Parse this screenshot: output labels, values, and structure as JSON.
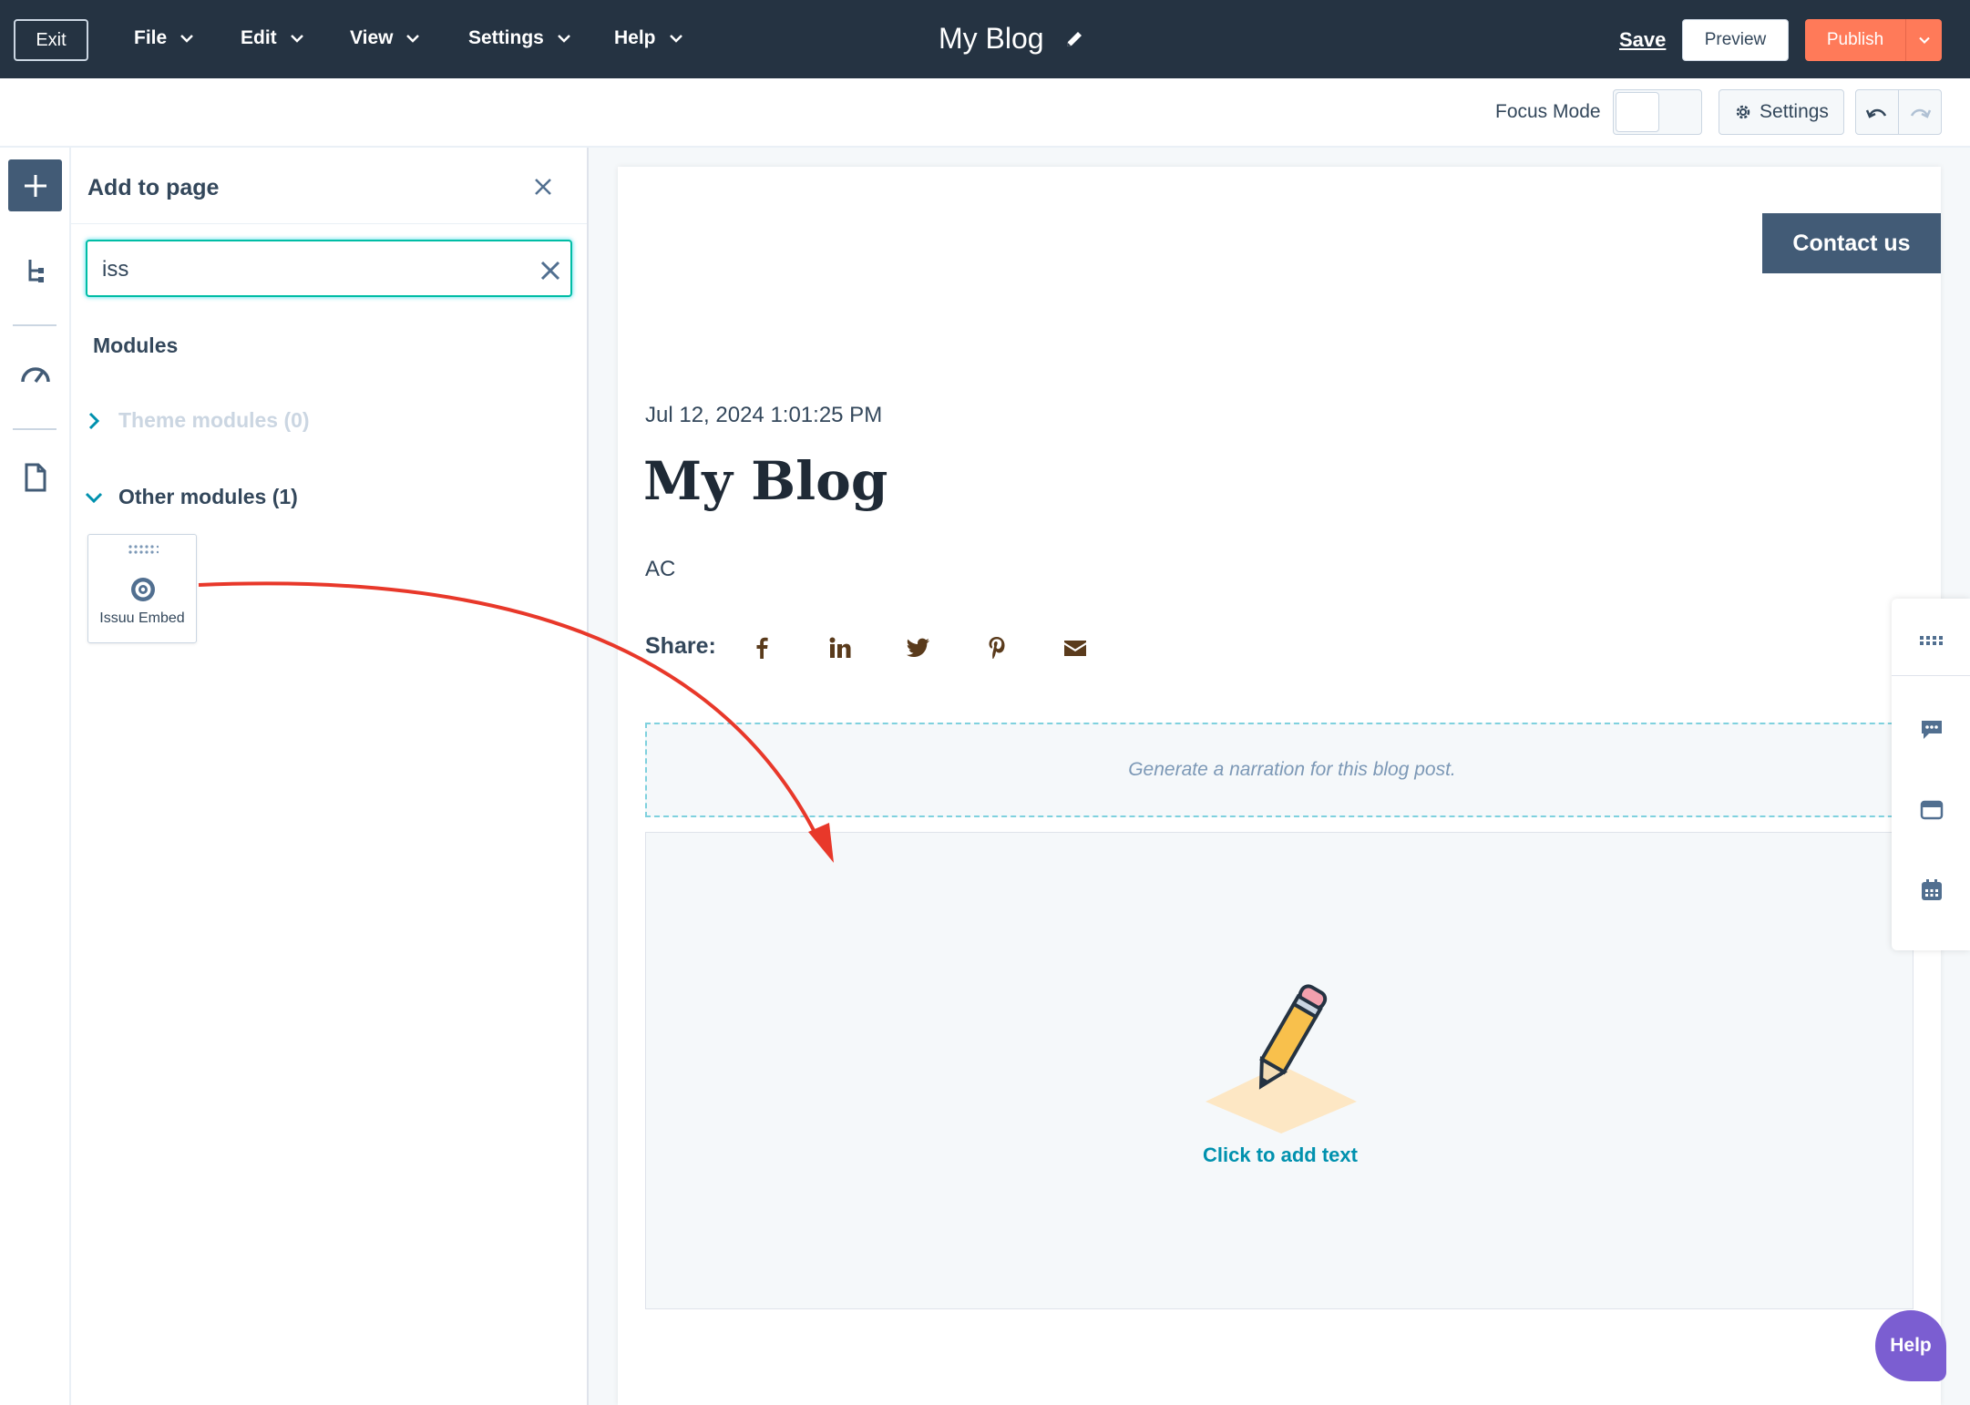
{
  "topbar": {
    "exit_label": "Exit",
    "menus": [
      "File",
      "Edit",
      "View",
      "Settings",
      "Help"
    ],
    "page_title": "My Blog",
    "save_label": "Save",
    "preview_label": "Preview",
    "publish_label": "Publish"
  },
  "toolbar": {
    "focus_mode_label": "Focus Mode",
    "settings_label": "Settings"
  },
  "panel": {
    "title": "Add to page",
    "search_value": "iss",
    "modules_heading": "Modules",
    "categories": [
      {
        "label": "Theme modules (0)",
        "expanded": false
      },
      {
        "label": "Other modules (1)",
        "expanded": true
      }
    ],
    "module_card": {
      "label": "Issuu Embed",
      "icon": "issuu-icon"
    }
  },
  "page": {
    "contact_label": "Contact us",
    "date": "Jul 12, 2024 1:01:25 PM",
    "title": "My Blog",
    "author": "AC",
    "share_label": "Share:",
    "share_icons": [
      "facebook-icon",
      "linkedin-icon",
      "twitter-icon",
      "pinterest-icon",
      "email-icon"
    ],
    "narration_text": "Generate a narration for this blog post.",
    "add_text_label": "Click to add text"
  },
  "help_label": "Help",
  "colors": {
    "topbar_bg": "#253342",
    "publish": "#ff7a59",
    "accent_teal": "#00bda5",
    "link": "#0091ae",
    "arrow": "#e8382a",
    "help": "#7b5ed1"
  }
}
